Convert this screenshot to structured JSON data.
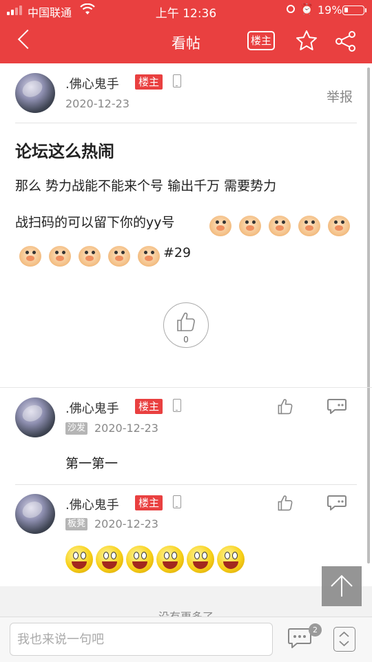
{
  "status_bar": {
    "carrier": "中国联通",
    "time": "上午 12:36",
    "battery_pct": "19%",
    "battery_level": 0.19
  },
  "nav": {
    "title": "看帖",
    "louzhu_btn": "楼主",
    "icons": [
      "back-icon",
      "star-icon",
      "share-icon"
    ]
  },
  "post": {
    "author": ".佛心鬼手",
    "badge": "楼主",
    "date": "2020-12-23",
    "report": "举报",
    "title": "论坛这么热闹",
    "body_line1": "那么 势力战能不能来个号  输出千万   需要势力",
    "body_line2": "战扫码的可以留下你的yy号",
    "body_tail": "#29",
    "emoji_count": 10,
    "likes": "0"
  },
  "replies": [
    {
      "author": ".佛心鬼手",
      "badge": "楼主",
      "floor": "沙发",
      "date": "2020-12-23",
      "text": "第一第一"
    },
    {
      "author": ".佛心鬼手",
      "badge": "楼主",
      "floor": "板凳",
      "date": "2020-12-23",
      "emoji_count": 6
    }
  ],
  "footer": {
    "no_more": "没有更多了",
    "input_placeholder": "我也来说一句吧",
    "comment_count": "2"
  },
  "colors": {
    "brand_red": "#e94040",
    "text_gray": "#888888"
  }
}
